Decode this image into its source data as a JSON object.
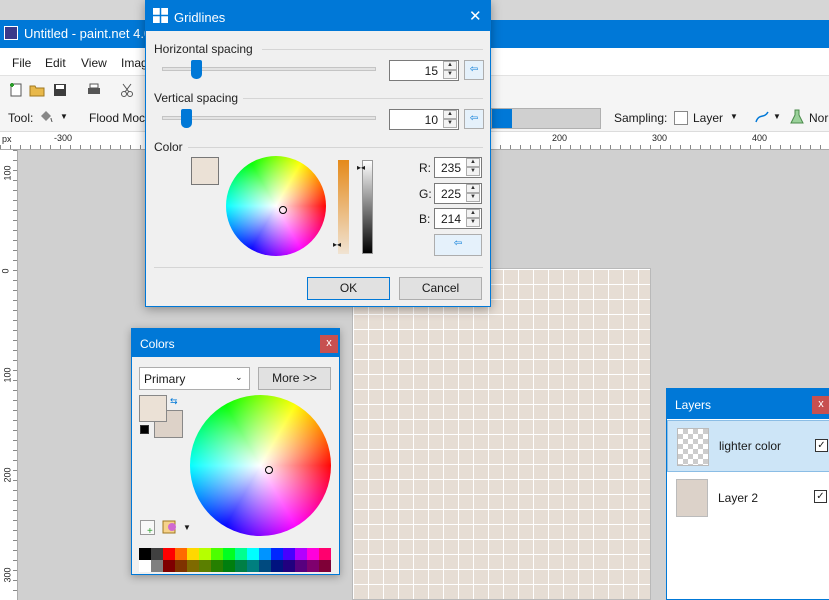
{
  "app": {
    "title": "Untitled - paint.net 4.0."
  },
  "menu": [
    "File",
    "Edit",
    "View",
    "Imag"
  ],
  "toolbar": {
    "tool_label": "Tool:",
    "flood_mode_label": "Flood Moc",
    "sampling_label": "Sampling:",
    "sampling_value": "Layer",
    "blend_label": "Nor"
  },
  "ruler": {
    "unit": "px",
    "top_ticks": [
      "-300",
      "200",
      "300",
      "400"
    ],
    "left_ticks": [
      "100",
      "0",
      "100",
      "200",
      "300"
    ]
  },
  "gridlines_dialog": {
    "title": "Gridlines",
    "horizontal": {
      "label": "Horizontal spacing",
      "value": "15"
    },
    "vertical": {
      "label": "Vertical spacing",
      "value": "10"
    },
    "color": {
      "label": "Color",
      "swatch": "#ebe1d6",
      "r_label": "R:",
      "r": "235",
      "g_label": "G:",
      "g": "225",
      "b_label": "B:",
      "b": "214"
    },
    "ok": "OK",
    "cancel": "Cancel"
  },
  "colors_panel": {
    "title": "Colors",
    "select_value": "Primary",
    "more_button": "More >>",
    "primary": "#ebe1d6",
    "secondary": "#ddd2c8",
    "palette_top": [
      "#000000",
      "#404040",
      "#ff0000",
      "#ff6a00",
      "#ffd800",
      "#b6ff00",
      "#4cff00",
      "#00ff21",
      "#00ff90",
      "#00ffff",
      "#0094ff",
      "#0026ff",
      "#4800ff",
      "#b200ff",
      "#ff00dc",
      "#ff006e"
    ],
    "palette_bottom": [
      "#ffffff",
      "#808080",
      "#7f0000",
      "#7f3300",
      "#7f6a00",
      "#5b7f00",
      "#267f00",
      "#007f0e",
      "#007f46",
      "#007f7f",
      "#004a7f",
      "#00137f",
      "#21007f",
      "#57007f",
      "#7f006e",
      "#7f0037"
    ]
  },
  "layers_panel": {
    "title": "Layers",
    "layers": [
      {
        "name": "lighter color",
        "visible": true
      },
      {
        "name": "Layer 2",
        "visible": true
      }
    ]
  },
  "colors": {
    "accent": "#0078d7",
    "canvas_bg": "#e6ddd4"
  }
}
